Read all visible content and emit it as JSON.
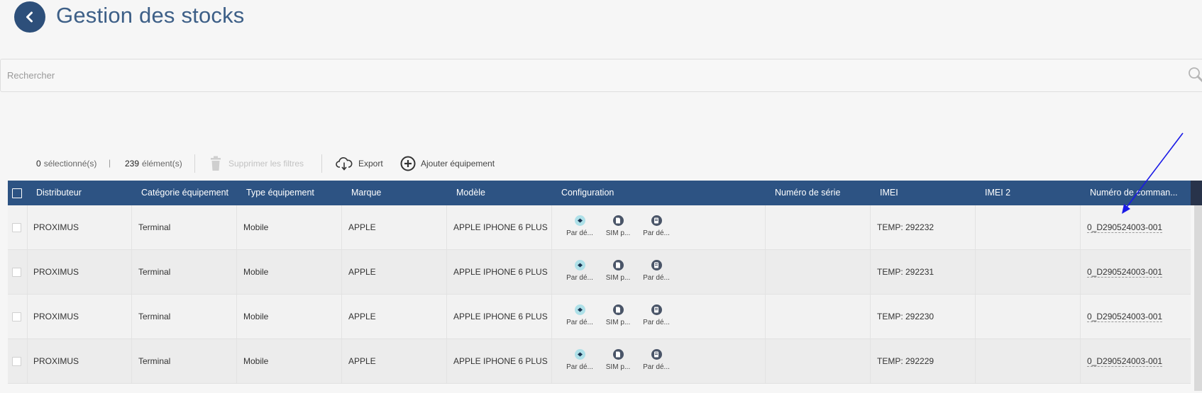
{
  "header": {
    "title": "Gestion des stocks"
  },
  "search": {
    "placeholder": "Rechercher",
    "value": ""
  },
  "toolbar": {
    "selected_count": "0",
    "selected_label": "sélectionné(s)",
    "separator": "|",
    "total_count": "239",
    "total_label": "élément(s)",
    "clear_filters_label": "Supprimer les filtres",
    "export_label": "Export",
    "add_label": "Ajouter équipement"
  },
  "table": {
    "columns": [
      "Distributeur",
      "Catégorie équipement",
      "Type équipement",
      "Marque",
      "Modèle",
      "Configuration",
      "Numéro de série",
      "IMEI",
      "IMEI 2",
      "Numéro de comman..."
    ],
    "rows": [
      {
        "distributeur": "PROXIMUS",
        "categorie": "Terminal",
        "type": "Mobile",
        "marque": "APPLE",
        "modele": "APPLE IPHONE 6 PLUS",
        "config": [
          "Par dé...",
          "SIM p...",
          "Par dé..."
        ],
        "serie": "",
        "imei": "TEMP: 292232",
        "imei2": "",
        "commande": "0_D290524003-001"
      },
      {
        "distributeur": "PROXIMUS",
        "categorie": "Terminal",
        "type": "Mobile",
        "marque": "APPLE",
        "modele": "APPLE IPHONE 6 PLUS",
        "config": [
          "Par dé...",
          "SIM p...",
          "Par dé..."
        ],
        "serie": "",
        "imei": "TEMP: 292231",
        "imei2": "",
        "commande": "0_D290524003-001"
      },
      {
        "distributeur": "PROXIMUS",
        "categorie": "Terminal",
        "type": "Mobile",
        "marque": "APPLE",
        "modele": "APPLE IPHONE 6 PLUS",
        "config": [
          "Par dé...",
          "SIM p...",
          "Par dé..."
        ],
        "serie": "",
        "imei": "TEMP: 292230",
        "imei2": "",
        "commande": "0_D290524003-001"
      },
      {
        "distributeur": "PROXIMUS",
        "categorie": "Terminal",
        "type": "Mobile",
        "marque": "APPLE",
        "modele": "APPLE IPHONE 6 PLUS",
        "config": [
          "Par dé...",
          "SIM p...",
          "Par dé..."
        ],
        "serie": "",
        "imei": "TEMP: 292229",
        "imei2": "",
        "commande": "0_D290524003-001"
      }
    ]
  },
  "icons": {
    "back": "chevron-left-icon",
    "search": "search-icon",
    "clear_filters": "trash-icon",
    "export": "cloud-download-icon",
    "add": "plus-circle-icon",
    "config": [
      "default-config-icon",
      "sim-card-icon",
      "device-settings-icon"
    ],
    "row_menu": "kebab-menu-icon"
  },
  "colors": {
    "header_bg": "#2d5383",
    "title": "#3d5f87",
    "back_button": "#2d4f7a",
    "annotation_arrow": "#1a1ae6"
  }
}
